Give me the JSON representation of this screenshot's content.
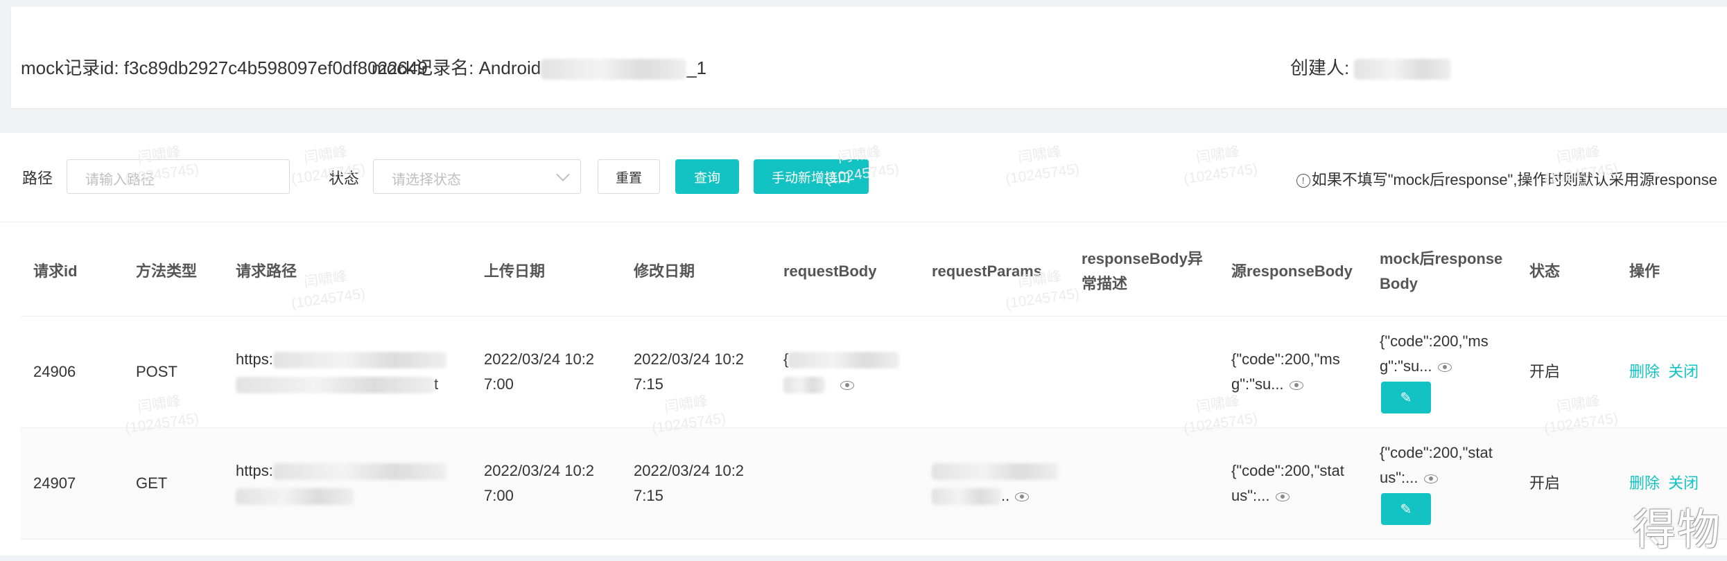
{
  "record": {
    "id_label": "mock记录id: f3c89db2927c4b598097ef0df8022649",
    "name_label": "mock记录名: Android",
    "name_suffix": "_1",
    "creator_label": "创建人: "
  },
  "filters": {
    "path_label": "路径",
    "path_placeholder": "请输入路径",
    "status_label": "状态",
    "status_placeholder": "请选择状态",
    "reset_label": "重置",
    "query_label": "查询",
    "add_label": "手动新增接口",
    "tip": "如果不填写\"mock后response\",操作时则默认采用源response"
  },
  "table": {
    "headers": {
      "id": "请求id",
      "method": "方法类型",
      "path": "请求路径",
      "upload": "上传日期",
      "modified": "修改日期",
      "req_body": "requestBody",
      "req_params": "requestParams",
      "exc_line1": "responseBody异",
      "exc_line2": "常描述",
      "src_resp": "源responseBody",
      "mock_line1": "mock后response",
      "mock_line2": "Body",
      "status": "状态",
      "action": "操作"
    },
    "rows": [
      {
        "id": "24906",
        "method": "POST",
        "path_line1": "https:",
        "path_line2": "",
        "path_tail": "t",
        "upload_line1": "2022/03/24 10:2",
        "upload_line2": "7:00",
        "modified_line1": "2022/03/24 10:2",
        "modified_line2": "7:15",
        "req_body": "{",
        "req_params": "",
        "src_line1": "{\"code\":200,\"ms",
        "src_line2": "g\":\"su...",
        "mock_line1": "{\"code\":200,\"ms",
        "mock_line2": "g\":\"su...",
        "status": "开启",
        "delete": "删除",
        "close": "关闭"
      },
      {
        "id": "24907",
        "method": "GET",
        "path_line1": "https:",
        "path_line2": "",
        "path_tail": "",
        "upload_line1": "2022/03/24 10:2",
        "upload_line2": "7:00",
        "modified_line1": "2022/03/24 10:2",
        "modified_line2": "7:15",
        "req_body": "",
        "req_params": "..",
        "src_line1": "{\"code\":200,\"stat",
        "src_line2": "us\":...",
        "mock_line1": "{\"code\":200,\"stat",
        "mock_line2": "us\":...",
        "status": "开启",
        "delete": "删除",
        "close": "关闭"
      }
    ]
  },
  "watermark": {
    "name": "闫啸峰",
    "code": "(10245745)"
  },
  "logo": "得物",
  "colors": {
    "primary": "#13c2c2",
    "background": "#f0f2f5"
  },
  "icons": [
    "info-icon",
    "chevron-down-icon",
    "eye-icon",
    "edit-icon"
  ]
}
